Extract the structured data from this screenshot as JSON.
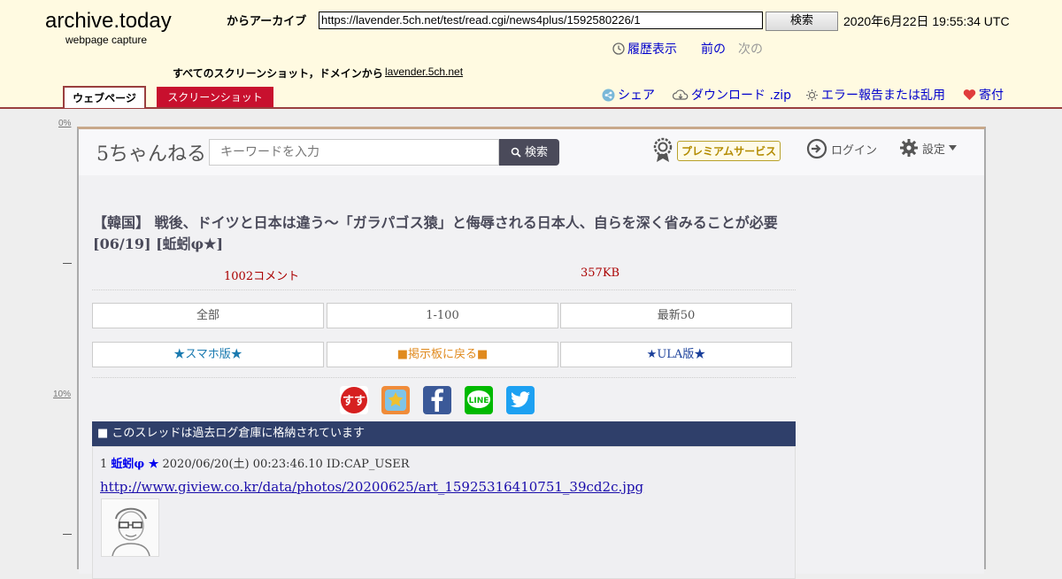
{
  "archive": {
    "title": "archive.today",
    "subtitle": "webpage capture",
    "from_label": "からアーカイブ",
    "url": "https://lavender.5ch.net/test/read.cgi/news4plus/1592580226/1",
    "search_label": "検索",
    "date": "2020年6月22日 19:55:34 UTC",
    "history_label": "履歴表示",
    "prev_label": "前の",
    "next_label": "次の",
    "all_screenshots_label": "すべてのスクリーンショット，ドメインから",
    "domain": "lavender.5ch.net",
    "tab_web": "ウェブページ",
    "tab_screenshot": "スクリーンショット",
    "share_label": "シェア",
    "download_label": "ダウンロード .zip",
    "report_label": "エラー報告または乱用",
    "donate_label": "寄付",
    "ruler": [
      "0%",
      "10%"
    ]
  },
  "site": {
    "logo": "5ちゃんねる",
    "search_placeholder": "キーワードを入力",
    "search_btn": "検索",
    "premium_label": "プレミアムサービス",
    "login_label": "ログイン",
    "settings_label": "設定"
  },
  "thread": {
    "title": "【韓国】 戦後、ドイツと日本は違う～「ガラパゴス猿」と侮辱される日本人、自らを深く省みることが必要[06/19] [蚯蚓φ★]",
    "comments": "1002コメント",
    "size": "357KB",
    "nav": [
      "全部",
      "1-100",
      "最新50"
    ],
    "nav2": [
      "★スマホ版★",
      "■掲示板に戻る■",
      "★ULA版★"
    ],
    "archived_notice": "■ このスレッドは過去ログ倉庫に格納されています",
    "post": {
      "number": "1",
      "name": "蚯蚓φ ★",
      "date": "2020/06/20(土) 00:23:46.10 ID:CAP_USER",
      "link": "http://www.giview.co.kr/data/photos/20200625/art_15925316410751_39cd2c.jpg"
    }
  },
  "colors": {
    "archive_bg": "#fffae1",
    "tab_red": "#c8102e",
    "dark_bar": "#2f3f6a",
    "premium": "#b38b00"
  }
}
